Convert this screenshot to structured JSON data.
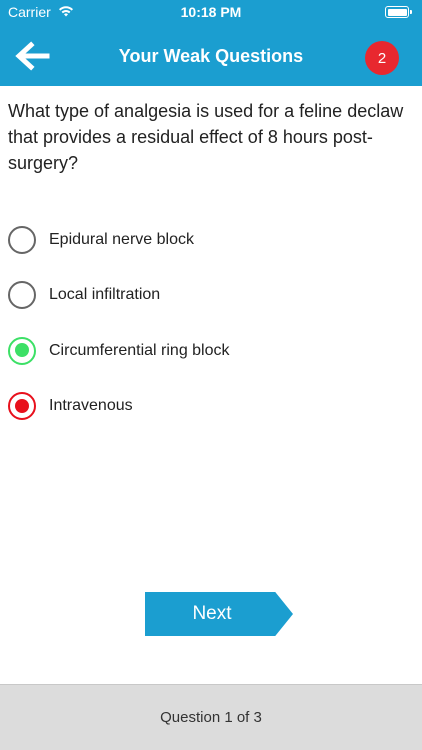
{
  "status_bar": {
    "carrier": "Carrier",
    "time": "10:18 PM"
  },
  "header": {
    "title": "Your Weak Questions",
    "badge_count": "2",
    "back_icon": "arrow-left-icon",
    "accent_color": "#1b9ed0",
    "badge_color": "#e8282f"
  },
  "question": {
    "text": "What type of analgesia is used for a feline declaw that provides a residual effect of 8 hours post-surgery?",
    "options": [
      {
        "label": "Epidural nerve block",
        "state": "unselected"
      },
      {
        "label": "Local infiltration",
        "state": "unselected"
      },
      {
        "label": "Circumferential ring block",
        "state": "correct"
      },
      {
        "label": "Intravenous",
        "state": "wrong"
      }
    ]
  },
  "next_button": {
    "label": "Next"
  },
  "footer": {
    "progress": "Question 1 of 3"
  },
  "colors": {
    "correct": "#3ce066",
    "wrong": "#e8101c"
  }
}
